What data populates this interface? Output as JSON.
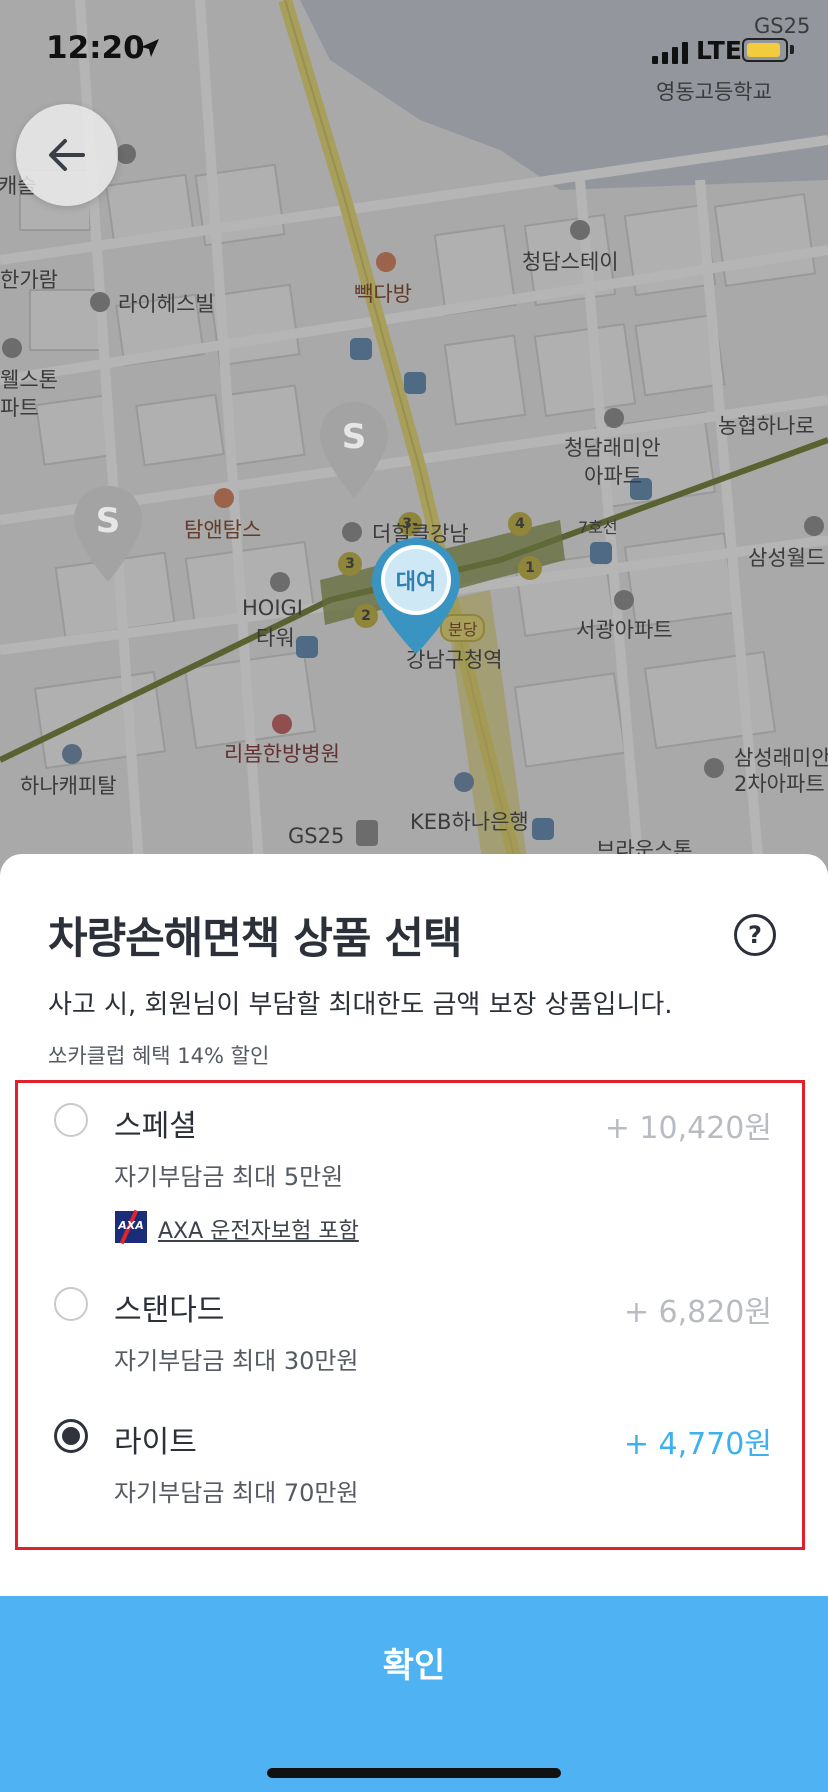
{
  "status_bar": {
    "time": "12:20",
    "network": "LTE"
  },
  "map": {
    "labels": [
      "영동고등학교",
      "GS25",
      "청담스테이",
      "빽다방",
      "라이헤스빌",
      "헤스트캐슬",
      "한가람",
      "웰스톤",
      "파트",
      "청담래미안",
      "아파트",
      "농협하나로",
      "탐앤탐스",
      "더힐클강남",
      "7호선",
      "삼성월드",
      "서광아파트",
      "HOIGI",
      "타워",
      "강남구청역",
      "분당",
      "리봄한방병원",
      "삼성래미안",
      "2차아파트",
      "하나캐피탈",
      "KEB하나은행",
      "GS25",
      "브라운스톤"
    ],
    "pickup_pin": "대여",
    "station_marker": "S",
    "line_numbers": [
      "3-1",
      "4",
      "3",
      "1",
      "2"
    ]
  },
  "sheet": {
    "title": "차량손해면책 상품 선택",
    "description": "사고 시, 회원님이 부담할 최대한도 금액 보장 상품입니다.",
    "discount_note": "쏘카클럽 혜택 14% 할인",
    "options": [
      {
        "name": "스페셜",
        "price": "+ 10,420원",
        "deductible": "자기부담금 최대 5만원",
        "selected": false,
        "insurance_link": "AXA 운전자보험 포함",
        "insurance_logo": "AXA"
      },
      {
        "name": "스탠다드",
        "price": "+ 6,820원",
        "deductible": "자기부담금 최대 30만원",
        "selected": false
      },
      {
        "name": "라이트",
        "price": "+ 4,770원",
        "deductible": "자기부담금 최대 70만원",
        "selected": true
      }
    ],
    "confirm_label": "확인"
  },
  "colors": {
    "accent": "#4fb3f3",
    "selected_price": "#3cb0f0",
    "highlight_border": "#e0202a"
  },
  "icons": [
    "back-arrow-icon",
    "location-arrow-icon",
    "signal-icon",
    "battery-icon",
    "help-icon",
    "radio-icon",
    "axa-logo-icon"
  ]
}
